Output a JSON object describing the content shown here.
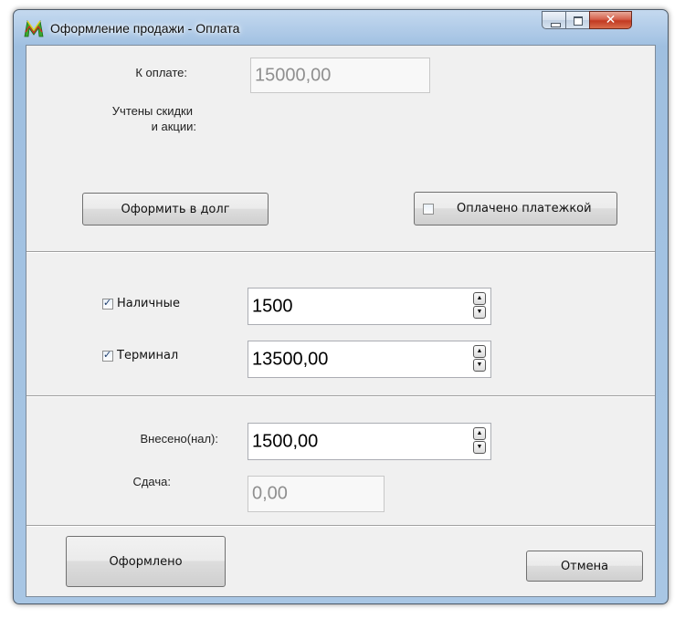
{
  "window": {
    "title": "Оформление продажи - Оплата",
    "close_glyph": "✕"
  },
  "summary": {
    "to_pay_label": "К оплате:",
    "to_pay_value": "15000,00",
    "discounts_line1": "Учтены скидки",
    "discounts_line2": "и акции:"
  },
  "actions": {
    "debt_button": "Оформить в долг",
    "paid_by_card_label": "Оплачено платежкой",
    "paid_by_card_checked": false
  },
  "payment": {
    "cash_label": "Наличные",
    "cash_checked": true,
    "cash_value": "1500",
    "terminal_label": "Терминал",
    "terminal_checked": true,
    "terminal_value": "13500,00"
  },
  "change": {
    "deposited_label": "Внесено(нал):",
    "deposited_value": "1500,00",
    "change_label": "Сдача:",
    "change_value": "0,00"
  },
  "footer": {
    "done_button": "Оформлено",
    "cancel_button": "Отмена"
  },
  "spin": {
    "up": "▲",
    "down": "▼"
  }
}
